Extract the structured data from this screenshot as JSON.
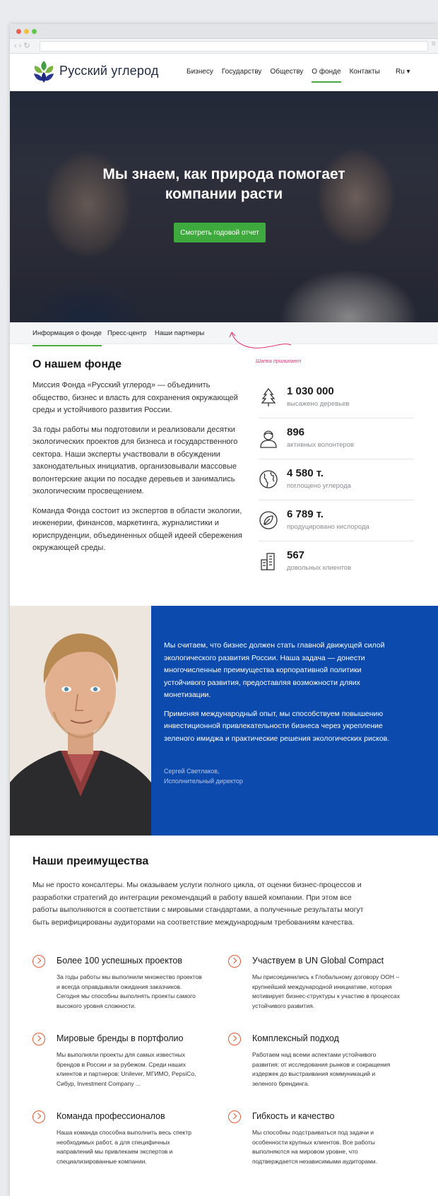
{
  "header": {
    "brand": "Русский углерод",
    "nav": [
      "Бизнесу",
      "Государству",
      "Обществу",
      "О фонде",
      "Контакты"
    ],
    "active_nav": "О фонде",
    "lang": "Ru ▾"
  },
  "hero": {
    "title_line1": "Мы знаем, как природа помогает",
    "title_line2": "компании расти",
    "button": "Смотреть годовой отчет"
  },
  "subnav": {
    "items": [
      "Информация о фонде",
      "Пресс-центр",
      "Наши партнеры"
    ],
    "annotation": "Шапка прилипает"
  },
  "about": {
    "title": "О нашем фонде",
    "paragraphs": [
      "Миссия Фонда «Русский углерод» — объединить общество, бизнес и власть для сохранения окружающей среды и устойчивого развития России.",
      "За годы работы мы подготовили и реализовали десятки экологических проектов для бизнеса и государственного сектора. Наши эксперты участвовали в обсуждении законодательных инициатив, организовывали массовые волонтерские акции по посадке деревьев и занимались экологическим просвещением.",
      "Команда Фонда состоит из экспертов в области экологии, инженерии, финансов, маркетинга, журналистики и юриспруденции, объединенных общей идеей сбережения окружающей среды."
    ],
    "stats": [
      {
        "value": "1 030 000",
        "label": "высажено деревьев",
        "icon": "tree-icon"
      },
      {
        "value": "896",
        "label": "активных волонтеров",
        "icon": "person-icon"
      },
      {
        "value": "4 580 т.",
        "label": "поглощено углерода",
        "icon": "globe-icon"
      },
      {
        "value": "6 789 т.",
        "label": "продуцировано кислорода",
        "icon": "leaf-icon"
      },
      {
        "value": "567",
        "label": "довольных клиентов",
        "icon": "buildings-icon"
      }
    ]
  },
  "quote": {
    "paragraphs": [
      "Мы считаем, что бизнес должен стать главной движущей силой экологического развития России. Наша задача — донести многочисленные преимущества корпоративной политики устойчивого развития, предоставляя возможности дляих монетизации.",
      "Применяя международный опыт, мы способствуем повышению инвестиционной привлекательности бизнеса через укрепление зеленого имиджа и практические решения экологических рисков."
    ],
    "author_name": "Сергей Светлаков,",
    "author_role": "Исполнительный директор"
  },
  "advantages": {
    "title": "Наши преимущества",
    "intro": "Мы не просто консалтеры. Мы оказываем услуги полного цикла, от оценки бизнес-процессов и разработки стратегий до интеграции рекомендаций в работу вашей компании. При этом все работы выполняются в соответствии с мировыми стандартами, а полученные результаты могут быть верифицированы аудиторами на соответствие международным требованиям качества.",
    "items": [
      {
        "title": "Более 100 успешных проектов",
        "desc": "За годы работы мы выполнили множество проектов и всегда оправдывали ожидания заказчиков. Сегодня мы способны выполнять проекты самого высокого уровня сложности."
      },
      {
        "title": "Участвуем в UN Global Compact",
        "desc": "Мы присоединились к Глобальному договору ООН – крупнейшей международной инициативе, которая мотивирует бизнес-структуры к участию в процессах устойчивого развития."
      },
      {
        "title": "Мировые бренды в портфолио",
        "desc": "Мы выполняли проекты для самых известных брендов в России и за рубежом. Среди наших клиентов и партнеров: Unilever, МГИМО, PepsiCo, Сибур, Investment Company ..."
      },
      {
        "title": "Комплексный подход",
        "desc": "Работаем над всеми аспектами устойчивого развития: от исследования рынков и сокращения издержек до выстраивания коммуникаций и зеленого брендинга."
      },
      {
        "title": "Команда профессионалов",
        "desc": "Наша команда способна выполнить весь спектр необходимых работ, а для специфичных направлений мы привлекаем экспертов и специализированные компании."
      },
      {
        "title": "Гибкость и качество",
        "desc": "Мы способны подстраиваться под задачи и особенности крупных клиентов. Все работы выполняются на мировом уровне, что подтверждается независимыми аудиторами."
      }
    ]
  },
  "colors": {
    "accent_green": "#3eaa3d",
    "quote_blue": "#0d4aad",
    "icon_orange": "#e45a32",
    "annotation_pink": "#e1356c"
  }
}
